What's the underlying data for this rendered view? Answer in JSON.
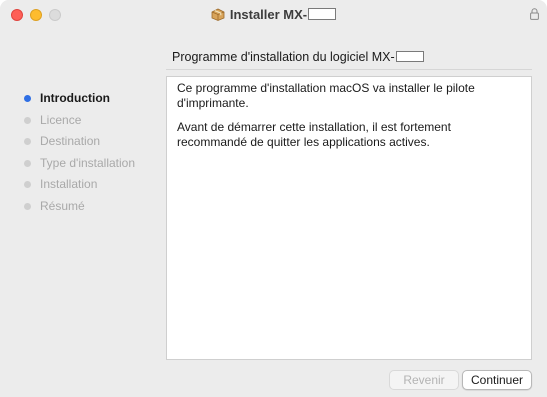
{
  "window": {
    "title": "Installer MX-",
    "title_icon": "package-icon",
    "lock_icon": "lock-icon"
  },
  "header": {
    "heading": "Programme d'installation du logiciel MX-"
  },
  "sidebar": {
    "steps": [
      {
        "label": "Introduction",
        "state": "active"
      },
      {
        "label": "Licence",
        "state": "inactive"
      },
      {
        "label": "Destination",
        "state": "inactive"
      },
      {
        "label": "Type d'installation",
        "state": "inactive"
      },
      {
        "label": "Installation",
        "state": "inactive"
      },
      {
        "label": "Résumé",
        "state": "inactive"
      }
    ]
  },
  "content": {
    "paragraphs": [
      "Ce programme d'installation macOS va installer le pilote d'imprimante.",
      "Avant de démarrer cette installation, il est fortement recommandé de quitter les applications actives."
    ]
  },
  "buttons": {
    "back_label": "Revenir",
    "back_enabled": false,
    "continue_label": "Continuer"
  },
  "colors": {
    "active_step": "#2f6fe4",
    "close": "#fe5f57",
    "minimize": "#febc2e",
    "maximize_disabled": "#dcdcdc"
  }
}
